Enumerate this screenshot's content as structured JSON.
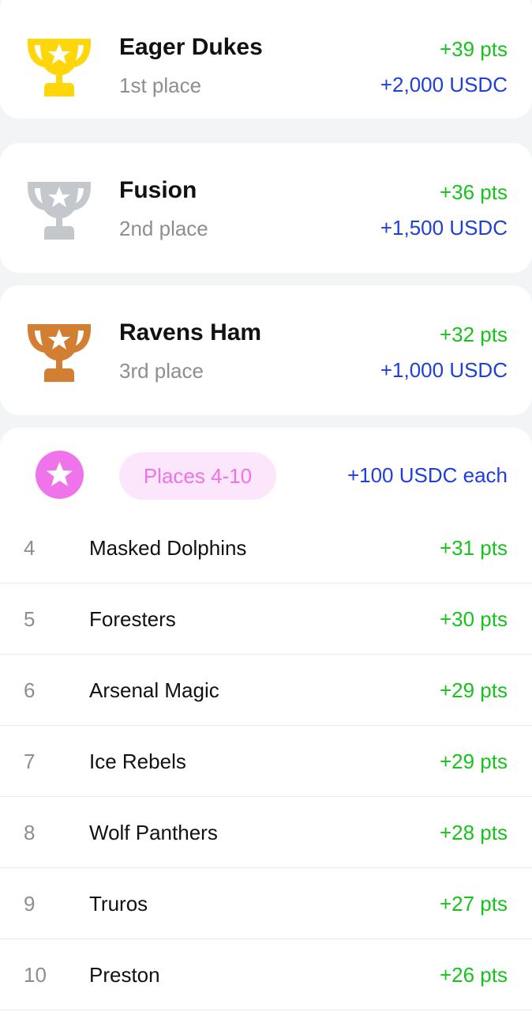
{
  "podium": [
    {
      "team": "Eager Dukes",
      "place": "1st place",
      "points": "+39 pts",
      "prize": "+2,000 USDC",
      "trophy_color": "#ffd60a",
      "icon": "gold-trophy-icon"
    },
    {
      "team": "Fusion",
      "place": "2nd place",
      "points": "+36 pts",
      "prize": "+1,500 USDC",
      "trophy_color": "#c4c7cc",
      "icon": "silver-trophy-icon"
    },
    {
      "team": "Ravens Ham",
      "place": "3rd place",
      "points": "+32 pts",
      "prize": "+1,000 USDC",
      "trophy_color": "#d27f33",
      "icon": "bronze-trophy-icon"
    }
  ],
  "others": {
    "label": "Places 4-10",
    "prize": "+100 USDC each",
    "badge_color": "#ef73eb",
    "icon": "star-badge-icon",
    "rows": [
      {
        "rank": "4",
        "team": "Masked Dolphins",
        "points": "+31 pts"
      },
      {
        "rank": "5",
        "team": "Foresters",
        "points": "+30 pts"
      },
      {
        "rank": "6",
        "team": "Arsenal Magic",
        "points": "+29 pts"
      },
      {
        "rank": "7",
        "team": "Ice Rebels",
        "points": "+29 pts"
      },
      {
        "rank": "8",
        "team": "Wolf Panthers",
        "points": "+28 pts"
      },
      {
        "rank": "9",
        "team": "Truros",
        "points": "+27 pts"
      },
      {
        "rank": "10",
        "team": "Preston",
        "points": "+26 pts"
      }
    ]
  },
  "colors": {
    "points_green": "#18c21e",
    "usdc_blue": "#1e3fd8",
    "muted_gray": "#8e8e8e"
  }
}
